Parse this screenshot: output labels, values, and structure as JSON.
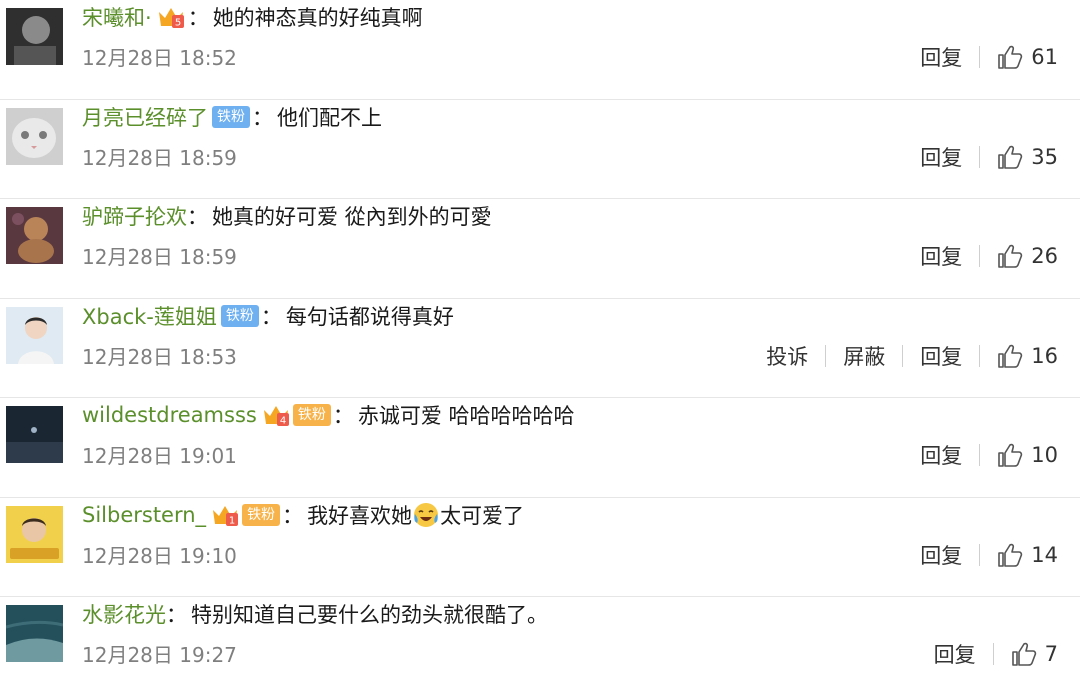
{
  "comments": [
    {
      "username": "宋曦和·",
      "badge_level": "5",
      "has_crown": true,
      "fan_badge": "",
      "text": "她的神态真的好纯真啊",
      "time": "12月28日 18:52",
      "actions": [
        "回复"
      ],
      "likes": "61",
      "avatar_colors": [
        "#3a3a3a",
        "#9a9a9a"
      ]
    },
    {
      "username": "月亮已经碎了",
      "has_crown": false,
      "fan_badge": "铁粉",
      "text": "他们配不上",
      "time": "12月28日 18:59",
      "actions": [
        "回复"
      ],
      "likes": "35",
      "avatar_colors": [
        "#bdbdbd",
        "#e8e8e8"
      ]
    },
    {
      "username": "驴蹄子抡欢",
      "has_crown": false,
      "fan_badge": "",
      "text": "她真的好可爱 從內到外的可愛",
      "time": "12月28日 18:59",
      "actions": [
        "回复"
      ],
      "likes": "26",
      "avatar_colors": [
        "#6b3f46",
        "#c48c5a"
      ]
    },
    {
      "username": "Xback-莲姐姐",
      "has_crown": false,
      "fan_badge": "铁粉",
      "text": "每句话都说得真好",
      "time": "12月28日 18:53",
      "actions": [
        "投诉",
        "屏蔽",
        "回复"
      ],
      "likes": "16",
      "avatar_colors": [
        "#cfe3ef",
        "#f2d9c8"
      ]
    },
    {
      "username": "wildestdreamsss",
      "badge_level": "4",
      "has_crown": true,
      "fan_badge": "铁粉",
      "text": "赤诚可爱 哈哈哈哈哈哈",
      "time": "12月28日 19:01",
      "actions": [
        "回复"
      ],
      "likes": "10",
      "avatar_colors": [
        "#1d2a3a",
        "#5c6e82"
      ]
    },
    {
      "username": "Silberstern_",
      "badge_level": "1",
      "has_crown": true,
      "fan_badge": "铁粉",
      "text": "我好喜欢她",
      "text_after": "太可爱了",
      "emoji": "crying-laughing",
      "time": "12月28日 19:10",
      "actions": [
        "回复"
      ],
      "likes": "14",
      "avatar_colors": [
        "#f2d24a",
        "#7a5a2a"
      ]
    },
    {
      "username": "水影花光",
      "has_crown": false,
      "fan_badge": "",
      "text": "特别知道自己要什么的劲头就很酷了。",
      "time": "12月28日 19:27",
      "actions": [
        "回复"
      ],
      "likes": "7",
      "avatar_colors": [
        "#2d5a66",
        "#8fb2b6"
      ]
    }
  ]
}
